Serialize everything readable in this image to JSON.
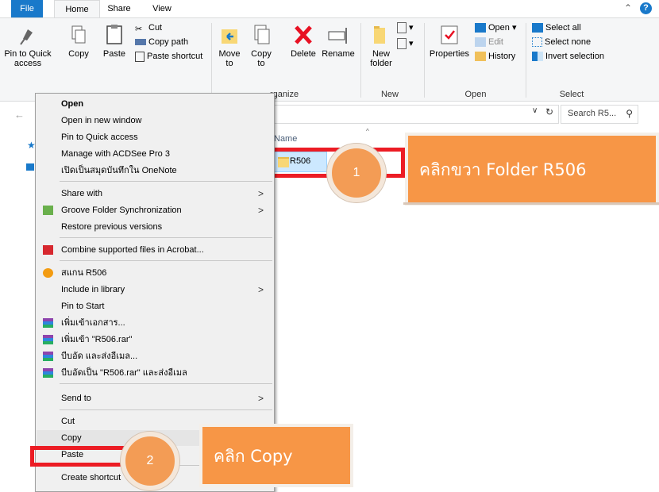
{
  "tabs": {
    "file": "File",
    "home": "Home",
    "share": "Share",
    "view": "View"
  },
  "ribbon": {
    "clipboard": {
      "pin": "Pin to Quick access",
      "copy": "Copy",
      "paste": "Paste",
      "cut": "Cut",
      "copy_path": "Copy path",
      "paste_shortcut": "Paste shortcut"
    },
    "organize": {
      "move": "Move to",
      "copy": "Copy to",
      "delete": "Delete",
      "rename": "Rename",
      "group": "rganize"
    },
    "new": {
      "folder": "New folder",
      "group": "New"
    },
    "open": {
      "properties": "Properties",
      "open": "Open",
      "edit": "Edit",
      "history": "History",
      "group": "Open"
    },
    "select": {
      "all": "Select all",
      "none": "Select none",
      "invert": "Invert selection",
      "group": "Select"
    }
  },
  "search": {
    "placeholder": "Search R5..."
  },
  "list": {
    "column_name": "Name",
    "item": "R506"
  },
  "context_menu": {
    "items": [
      {
        "label": "Open"
      },
      {
        "label": "Open in new window"
      },
      {
        "label": "Pin to Quick access"
      },
      {
        "label": "Manage with ACDSee Pro 3"
      },
      {
        "label": "เปิดเป็นสมุดบันทึกใน OneNote"
      },
      {
        "label": "Share with"
      },
      {
        "label": "Groove Folder Synchronization"
      },
      {
        "label": "Restore previous versions"
      },
      {
        "label": "Combine supported files in Acrobat..."
      },
      {
        "label": "สแกน R506"
      },
      {
        "label": "Include in library"
      },
      {
        "label": "Pin to Start"
      },
      {
        "label": "เพิ่มเข้าเอกสาร..."
      },
      {
        "label": "เพิ่มเข้า \"R506.rar\""
      },
      {
        "label": "บีบอัด และส่งอีเมล..."
      },
      {
        "label": "บีบอัดเป็น \"R506.rar\" และส่งอีเมล"
      },
      {
        "label": "Send to"
      },
      {
        "label": "Cut"
      },
      {
        "label": "Copy"
      },
      {
        "label": "Paste"
      },
      {
        "label": "Create shortcut"
      }
    ]
  },
  "callouts": {
    "step1_number": "1",
    "step1_text": "คลิกขวา Folder R506",
    "step2_number": "2",
    "step2_text": "คลิก Copy"
  },
  "colors": {
    "accent": "#1979ca",
    "callout": "#f79646",
    "highlight": "#ec1c24"
  }
}
